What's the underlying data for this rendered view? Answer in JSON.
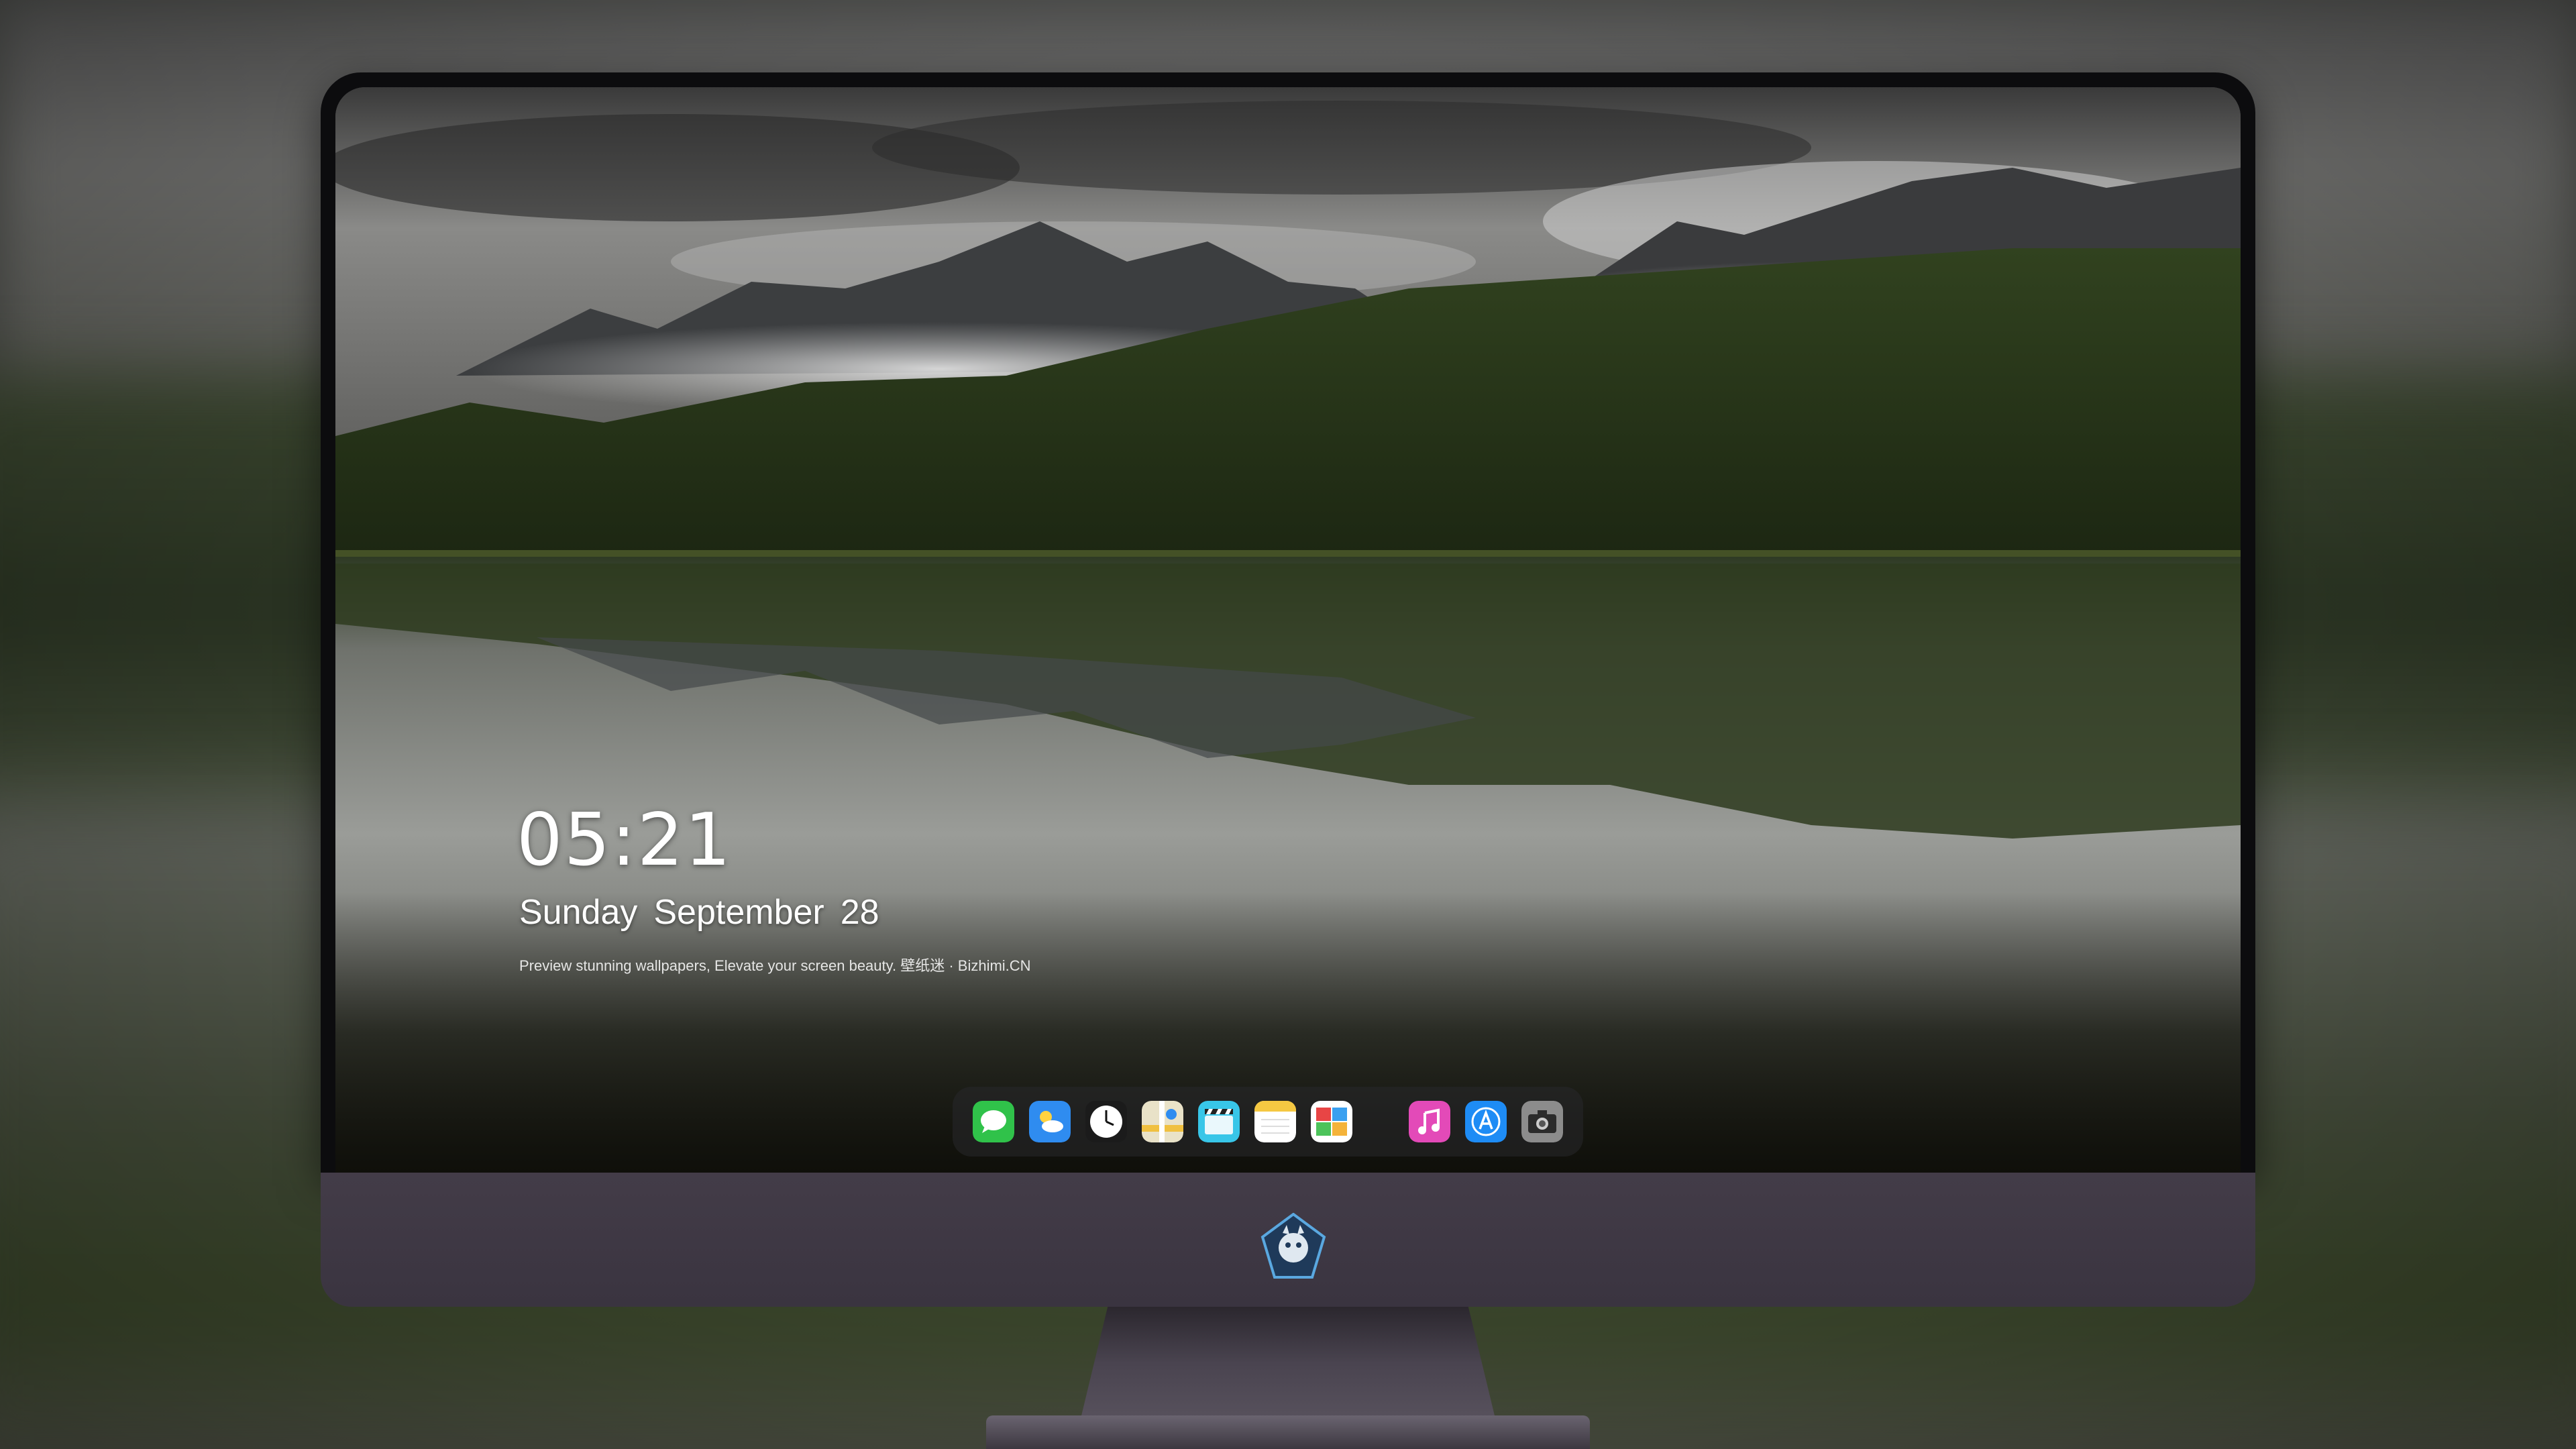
{
  "lock_screen": {
    "time": "05:21",
    "weekday": "Sunday",
    "month": "September",
    "day": "28",
    "tagline": "Preview stunning wallpapers, Elevate your screen beauty. 壁纸迷 · Bizhimi.CN"
  },
  "dock": {
    "apps": [
      {
        "icon": "messages-icon",
        "color": "#2ecc40"
      },
      {
        "icon": "weather-icon",
        "color": "#2f8cf0"
      },
      {
        "icon": "clock-icon",
        "color": "#ffffff"
      },
      {
        "icon": "maps-icon",
        "color": "#f0c040"
      },
      {
        "icon": "clips-icon",
        "color": "#38c6e8"
      },
      {
        "icon": "notes-icon",
        "color": "#f5c842"
      },
      {
        "icon": "calendar-icon",
        "color": "#e84545"
      },
      {
        "icon": "music-icon",
        "color": "#e34ab8"
      },
      {
        "icon": "app-store-icon",
        "color": "#1e8cf5"
      },
      {
        "icon": "camera-icon",
        "color": "#8c8c8c"
      }
    ]
  },
  "hardware": {
    "logo": "dragon-mascot-logo",
    "bezel_color": "#0c0c0e",
    "chin_color": "#3d3642"
  }
}
